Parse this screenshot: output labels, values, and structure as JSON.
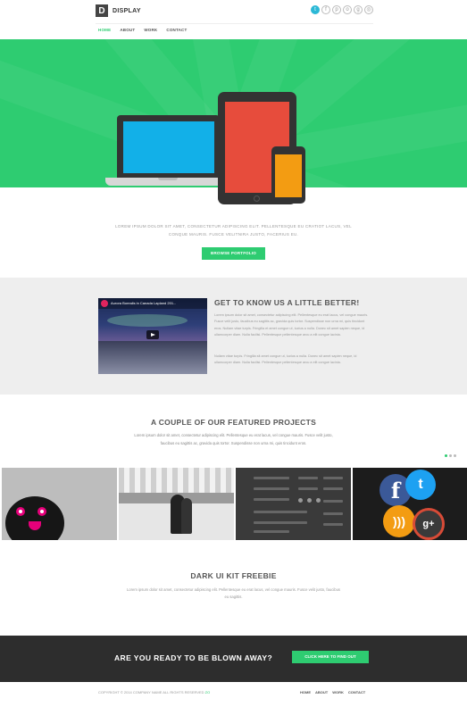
{
  "header": {
    "logo_letter": "D",
    "logo_text": "DISPLAY",
    "social_icons": [
      "twitter",
      "facebook",
      "pinterest",
      "dribbble",
      "google-plus",
      "instagram"
    ],
    "nav": [
      "HOME",
      "ABOUT",
      "WORK",
      "CONTACT"
    ]
  },
  "hero": {
    "colors": {
      "bg": "#2ecc71",
      "laptop": "#12b0e8",
      "tablet": "#e74c3c",
      "phone": "#f39c12"
    },
    "intro_line1": "LOREM IPSUM DOLOR SIT AMET, CONSECTETUR ADIPISCING ELIT. PELLENTESQUE EU CRATIOT LACUS, VEL",
    "intro_line2": "CONQUE MAURIS. FUSCE VELITNIRA JUSTO, FACERIUS EU.",
    "button": "BROWSE PORTFOLIO"
  },
  "about": {
    "video_title": "Aurora Borealis in Canada Lapland 201...",
    "title": "GET TO KNOW US A LITTLE BETTER!",
    "paragraph1": "Lorem ipsum dolor sit amet, consectetur adipiscing elit. Pellentesque eu erat lacus, vel congue mauris. Fusce velit justo, faucibus eu sagittis ac, gravida quis tortor. Suspendisse non urna mi, quis tincidunt eros. Nullam vitae turpis. Fringilla et amet congue ut, luctus a nulla. Donec sit amet sapien neque, id ullamcorper diam. Nulla facilisi. Pellentesque pellentesque arcu a elit congue lacinia.",
    "paragraph2": "Nullam vitae turpis. Fringilla sit amet congue ut, luctus a nulla. Donec sit amet sapien neque, id ullamcorper diam. Nulla facilisi. Pellentesque pellentesque arcu a elit congue lacinia."
  },
  "projects": {
    "title": "A COUPLE OF OUR FEATURED PROJECTS",
    "description": "Lorem ipsum dolor sit amet, consectetur adipiscing elit. Pellentesque eu erat lacus, vel congue mauris. Fusce velit justo, faucibus eu sagittis ac, gravida quis tortor. Suspendisse non urna mi, quis tincidunt eros.",
    "thumbs": [
      "monster-illustration",
      "ice-skaters-photo",
      "dark-ui-kit",
      "social-icons"
    ],
    "social_glyphs": {
      "fb": "f",
      "tw": "t",
      "rss": ")))",
      "gp": "g+"
    }
  },
  "dark_ui": {
    "title": "DARK UI KIT FREEBIE",
    "description": "Lorem ipsum dolor sit amet, consectetur adipiscing elit. Pellentesque eu erat lacus, vel congue mauris. Fusce velit justo, faucibus eu sagittis."
  },
  "cta": {
    "text": "ARE YOU READY TO BE BLOWN AWAY?",
    "button": "CLICK HERE TO FIND OUT"
  },
  "footer": {
    "copyright": "COPYRIGHT © 2014 COMPANY NAME ALL RIGHTS RESERVED",
    "link": "ZO",
    "nav": [
      "HOME",
      "ABOUT",
      "WORK",
      "CONTACT"
    ]
  }
}
